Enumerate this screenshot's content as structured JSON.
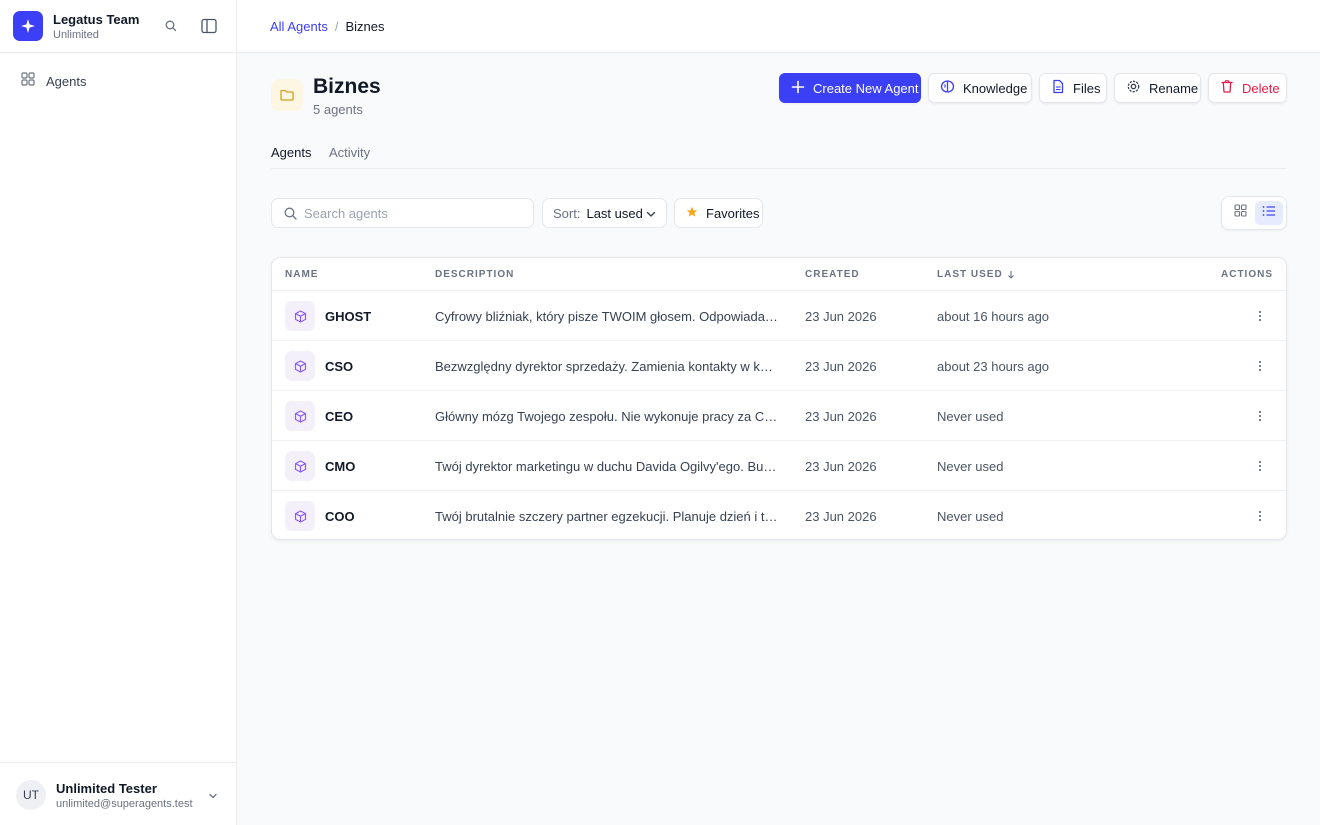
{
  "team": {
    "name": "Legatus Team",
    "plan": "Unlimited"
  },
  "sidebar": {
    "items": [
      {
        "label": "Agents",
        "icon": "grid-icon"
      }
    ]
  },
  "user": {
    "initials": "UT",
    "name": "Unlimited Tester",
    "email": "unlimited@superagents.test"
  },
  "breadcrumb": {
    "root": "All Agents",
    "separator": "/",
    "current": "Biznes"
  },
  "header": {
    "title": "Biznes",
    "subtitle": "5 agents",
    "buttons": {
      "create": "Create New Agent",
      "knowledge": "Knowledge",
      "files": "Files",
      "rename": "Rename",
      "delete": "Delete"
    }
  },
  "tabs": [
    {
      "label": "Agents",
      "active": true
    },
    {
      "label": "Activity",
      "active": false
    }
  ],
  "filters": {
    "search_placeholder": "Search agents",
    "search_value": "",
    "sort_label": "Sort:",
    "sort_value": "Last used",
    "favorites_label": "Favorites",
    "view_mode": "list"
  },
  "table": {
    "columns": {
      "name": "NAME",
      "description": "DESCRIPTION",
      "created": "CREATED",
      "last_used": "LAST USED",
      "actions": "ACTIONS"
    },
    "rows": [
      {
        "name": "GHOST",
        "description": "Cyfrowy bliźniak, który pisze TWOIM głosem. Odpowiada za Ciebie",
        "created": "23 Jun 2026",
        "last_used": "about 16 hours ago"
      },
      {
        "name": "CSO",
        "description": "Bezwzględny dyrektor sprzedaży. Zamienia kontakty w kasę. Od pierwszego",
        "created": "23 Jun 2026",
        "last_used": "about 23 hours ago"
      },
      {
        "name": "CEO",
        "description": "Główny mózg Twojego zespołu. Nie wykonuje pracy za Ciebie — myśli",
        "created": "23 Jun 2026",
        "last_used": "Never used"
      },
      {
        "name": "CMO",
        "description": "Twój dyrektor marketingu w duchu Davida Ogilvy'ego. Buduje markę",
        "created": "23 Jun 2026",
        "last_used": "Never used"
      },
      {
        "name": "COO",
        "description": "Twój brutalnie szczery partner egzekucji. Planuje dzień i tydzień",
        "created": "23 Jun 2026",
        "last_used": "Never used"
      }
    ]
  },
  "colors": {
    "accent": "#3b3ff5",
    "danger": "#e11d48",
    "favorite": "#f5a623",
    "agent_icon": "#8b5cf6",
    "folder": "#d4a020"
  }
}
